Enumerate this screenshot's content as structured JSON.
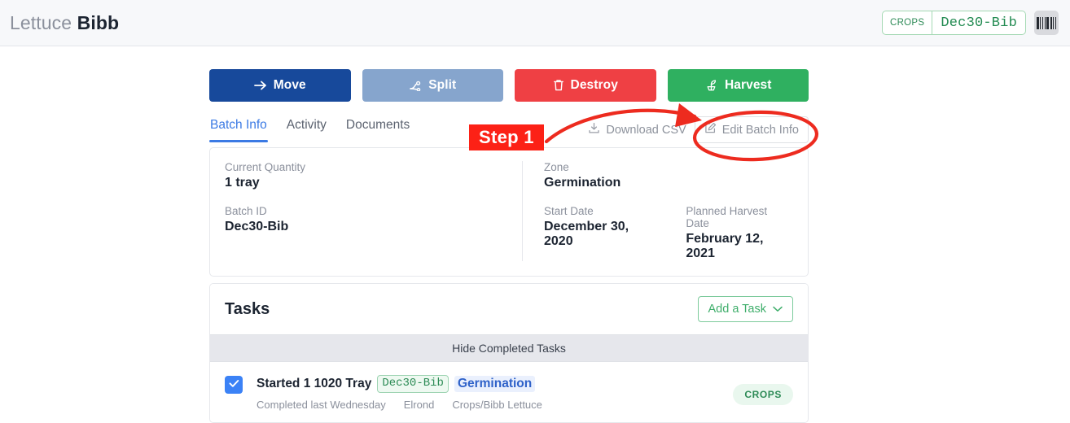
{
  "header": {
    "title_prefix": "Lettuce",
    "title_main": "Bibb",
    "badge_context": "CROPS",
    "badge_value": "Dec30-Bib",
    "barcode_icon": "barcode-icon"
  },
  "actions": [
    {
      "label": "Move",
      "icon": "arrow-right-icon",
      "color": "#17499b"
    },
    {
      "label": "Split",
      "icon": "split-branch-icon",
      "color": "#86a5cd"
    },
    {
      "label": "Destroy",
      "icon": "trash-icon",
      "color": "#ef4044"
    },
    {
      "label": "Harvest",
      "icon": "sprout-icon",
      "color": "#2fb060"
    }
  ],
  "tabs": [
    {
      "label": "Batch Info",
      "active": true
    },
    {
      "label": "Activity",
      "active": false
    },
    {
      "label": "Documents",
      "active": false
    }
  ],
  "toolbar": {
    "download_label": "Download CSV",
    "download_icon": "download-icon",
    "edit_label": "Edit Batch Info",
    "edit_icon": "pencil-square-icon"
  },
  "batch_info": {
    "current_quantity_label": "Current Quantity",
    "current_quantity_value": "1 tray",
    "batch_id_label": "Batch ID",
    "batch_id_value": "Dec30-Bib",
    "zone_label": "Zone",
    "zone_value": "Germination",
    "start_date_label": "Start Date",
    "start_date_value": "December 30, 2020",
    "planned_harvest_label": "Planned Harvest Date",
    "planned_harvest_value": "February 12, 2021"
  },
  "tasks": {
    "heading": "Tasks",
    "add_task_label": "Add a Task",
    "add_task_icon": "chevron-down-icon",
    "hide_completed_label": "Hide Completed Tasks",
    "rows": [
      {
        "checked": true,
        "title": "Started 1 1020 Tray",
        "code_chip": "Dec30-Bib",
        "zone_chip": "Germination",
        "meta_status": "Completed last Wednesday",
        "meta_user": "Elrond",
        "meta_path": "Crops/Bibb Lettuce",
        "pill": "CROPS"
      }
    ]
  },
  "annotations": {
    "step_label": "Step 1",
    "accent_color": "#fc2116",
    "arrow": "curved-arrow-pointing-to-edit-batch-info",
    "ellipse": "red-ellipse-around-edit-batch-info"
  }
}
